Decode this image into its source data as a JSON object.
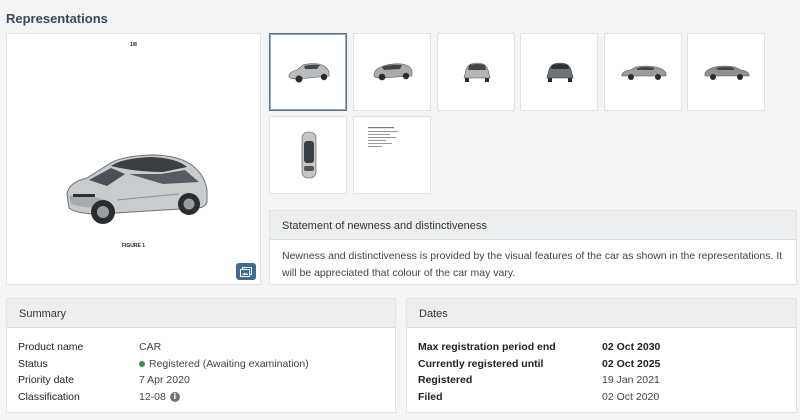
{
  "page": {
    "title": "Representations"
  },
  "main_image": {
    "page_number": "1/8",
    "figure_label": "FIGURE 1"
  },
  "thumbnails": [
    {
      "view": "perspective-front",
      "selected": true
    },
    {
      "view": "perspective-rear",
      "selected": false
    },
    {
      "view": "front",
      "selected": false
    },
    {
      "view": "rear",
      "selected": false
    },
    {
      "view": "side-left",
      "selected": false
    },
    {
      "view": "side-right",
      "selected": false
    },
    {
      "view": "top",
      "selected": false
    },
    {
      "view": "text-document",
      "selected": false
    }
  ],
  "statement": {
    "title": "Statement of newness and distinctiveness",
    "text": "Newness and distinctiveness is provided by the visual features of the car as shown in the representations. It will be appreciated that colour of the car may vary."
  },
  "summary": {
    "title": "Summary",
    "rows": [
      {
        "label": "Product name",
        "value": "CAR"
      },
      {
        "label": "Status",
        "value": "Registered (Awaiting examination)",
        "status_color": "#2e9b3f"
      },
      {
        "label": "Priority date",
        "value": "7 Apr 2020"
      },
      {
        "label": "Classification",
        "value": "12-08",
        "info_icon": "info-icon"
      }
    ]
  },
  "dates": {
    "title": "Dates",
    "rows": [
      {
        "label": "Max registration period end",
        "value": "02 Oct 2030",
        "bold": true
      },
      {
        "label": "Currently registered until",
        "value": "02 Oct 2025",
        "bold": true
      },
      {
        "label": "Registered",
        "value": "19 Jan 2021",
        "bold": false
      },
      {
        "label": "Filed",
        "value": "02 Oct 2020",
        "bold": false
      }
    ]
  },
  "colors": {
    "accent": "#3c6c95",
    "status_green": "#2e9b3f",
    "title": "#3b4a58"
  }
}
